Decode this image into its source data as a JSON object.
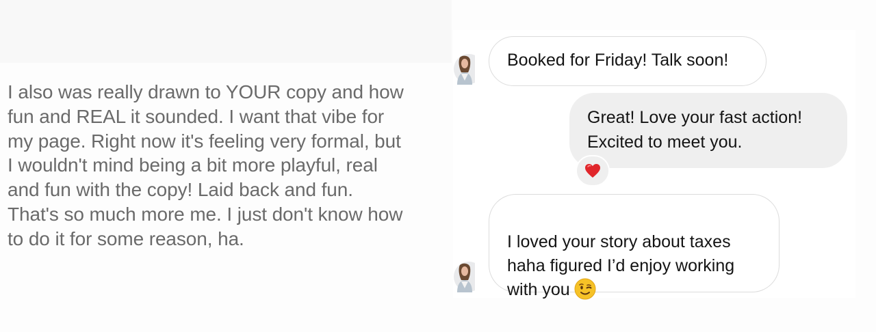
{
  "left_message": {
    "text": "I also was really drawn to YOUR copy and how\nfun and REAL it sounded. I want that vibe for\nmy page. Right now it's feeling very formal, but\nI wouldn't mind being a bit more playful, real\nand fun with the copy! Laid back and fun.\nThat's so much more me. I just don't know how\nto do it for some reason, ha."
  },
  "chat": {
    "messages": [
      {
        "direction": "incoming",
        "text": "Booked for Friday! Talk soon!",
        "avatar_icon": "contact-avatar-icon"
      },
      {
        "direction": "outgoing",
        "text": "Great! Love your fast action!\nExcited to meet you.",
        "reaction_icon": "red-heart-icon"
      },
      {
        "direction": "incoming",
        "text": "I loved your story about taxes\nhaha figured I’d enjoy working\nwith you",
        "trailing_emoji_icon": "winking-face-icon",
        "avatar_icon": "contact-avatar-icon"
      }
    ]
  },
  "colors": {
    "left_text": "#6a6a6a",
    "bubble_text": "#141414",
    "incoming_border": "#dcdcdc",
    "outgoing_fill": "#efefef",
    "heart": "#e0262b",
    "emoji": "#f6c227"
  }
}
